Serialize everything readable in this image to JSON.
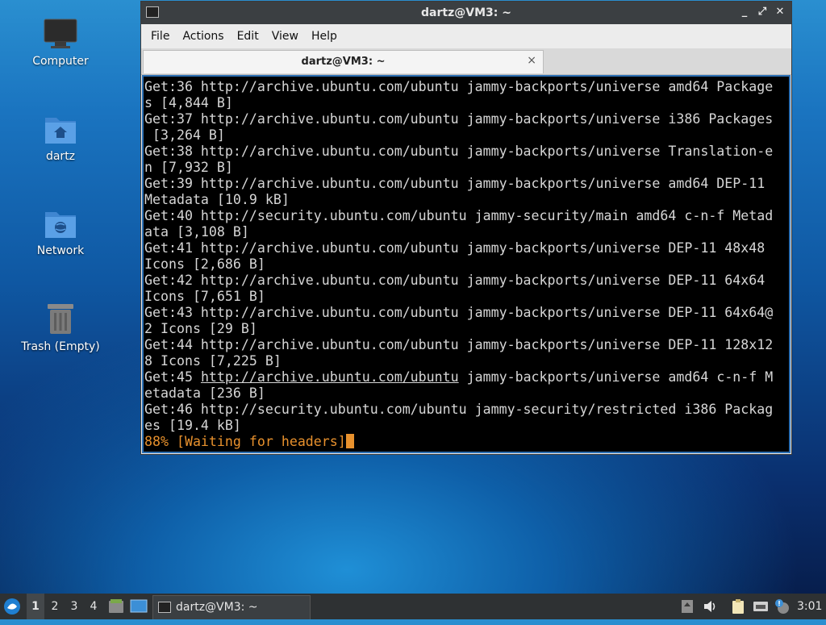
{
  "desktop": {
    "icons": [
      {
        "label": "Computer"
      },
      {
        "label": "dartz"
      },
      {
        "label": "Network"
      },
      {
        "label": "Trash (Empty)"
      }
    ]
  },
  "window": {
    "title": "dartz@VM3: ~",
    "controls": {
      "minimize": "_",
      "maximize": "⤢",
      "close": "✕"
    },
    "menu": [
      "File",
      "Actions",
      "Edit",
      "View",
      "Help"
    ],
    "tab": {
      "label": "dartz@VM3: ~",
      "close": "×"
    },
    "terminal": {
      "lines": [
        "Get:36 http://archive.ubuntu.com/ubuntu jammy-backports/universe amd64 Package",
        "s [4,844 B]",
        "Get:37 http://archive.ubuntu.com/ubuntu jammy-backports/universe i386 Packages",
        " [3,264 B]",
        "Get:38 http://archive.ubuntu.com/ubuntu jammy-backports/universe Translation-e",
        "n [7,932 B]",
        "Get:39 http://archive.ubuntu.com/ubuntu jammy-backports/universe amd64 DEP-11",
        "Metadata [10.9 kB]",
        "Get:40 http://security.ubuntu.com/ubuntu jammy-security/main amd64 c-n-f Metad",
        "ata [3,108 B]",
        "Get:41 http://archive.ubuntu.com/ubuntu jammy-backports/universe DEP-11 48x48",
        "Icons [2,686 B]",
        "Get:42 http://archive.ubuntu.com/ubuntu jammy-backports/universe DEP-11 64x64",
        "Icons [7,651 B]",
        "Get:43 http://archive.ubuntu.com/ubuntu jammy-backports/universe DEP-11 64x64@",
        "2 Icons [29 B]",
        "Get:44 http://archive.ubuntu.com/ubuntu jammy-backports/universe DEP-11 128x12",
        "8 Icons [7,225 B]"
      ],
      "line45_prefix": "Get:45 ",
      "line45_link": "http://archive.ubuntu.com/ubuntu",
      "line45_suffix": " jammy-backports/universe amd64 c-n-f M",
      "lines_after": [
        "etadata [236 B]",
        "Get:46 http://security.ubuntu.com/ubuntu jammy-security/restricted i386 Packag",
        "es [19.4 kB]"
      ],
      "progress_text": "88% [Waiting for headers]",
      "progress_color": "#e8912d"
    }
  },
  "taskbar": {
    "workspaces": [
      "1",
      "2",
      "3",
      "4"
    ],
    "active_workspace": "1",
    "task_label": "dartz@VM3: ~",
    "clock": "3:01",
    "icons": [
      "start-menu-icon",
      "file-manager-icon",
      "show-desktop-icon",
      "update-notifier-icon",
      "volume-icon",
      "clipboard-icon",
      "network-icon",
      "notification-icon"
    ]
  }
}
